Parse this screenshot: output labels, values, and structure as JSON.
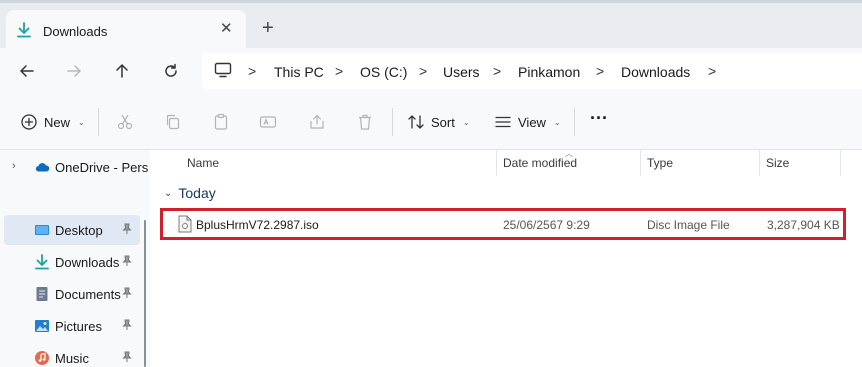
{
  "tab": {
    "title": "Downloads",
    "close_glyph": "✕",
    "new_tab_glyph": "+"
  },
  "nav": {
    "back": "back-arrow-icon",
    "forward": "forward-arrow-icon",
    "up": "up-arrow-icon",
    "refresh": "refresh-icon"
  },
  "breadcrumb": {
    "items": [
      "This PC",
      "OS (C:)",
      "Users",
      "Pinkamon",
      "Downloads"
    ],
    "separator": ">"
  },
  "toolbar": {
    "new_label": "New",
    "sort_label": "Sort",
    "view_label": "View",
    "more_label": "···",
    "icons": [
      "cut-icon",
      "copy-icon",
      "paste-icon",
      "rename-icon",
      "share-icon",
      "delete-icon"
    ]
  },
  "sidebar": {
    "items": [
      {
        "label": "OneDrive - Pers",
        "icon": "cloud-icon"
      },
      {
        "label": "Desktop",
        "icon": "desktop-icon",
        "selected": true,
        "pinned": true
      },
      {
        "label": "Downloads",
        "icon": "download-icon",
        "pinned": true
      },
      {
        "label": "Documents",
        "icon": "document-icon",
        "pinned": true
      },
      {
        "label": "Pictures",
        "icon": "pictures-icon",
        "pinned": true
      },
      {
        "label": "Music",
        "icon": "music-icon",
        "pinned": true
      }
    ]
  },
  "columns": {
    "name": "Name",
    "date": "Date modified",
    "type": "Type",
    "size": "Size"
  },
  "group": {
    "label": "Today"
  },
  "files": [
    {
      "name": "BplusHrmV72.2987.iso",
      "date": "25/06/2567 9:29",
      "type": "Disc Image File",
      "size": "3,287,904 KB"
    }
  ],
  "colors": {
    "highlight_border": "#d0202e",
    "accent": "#0f8a8a",
    "selected_bg": "#dfe8f3"
  }
}
